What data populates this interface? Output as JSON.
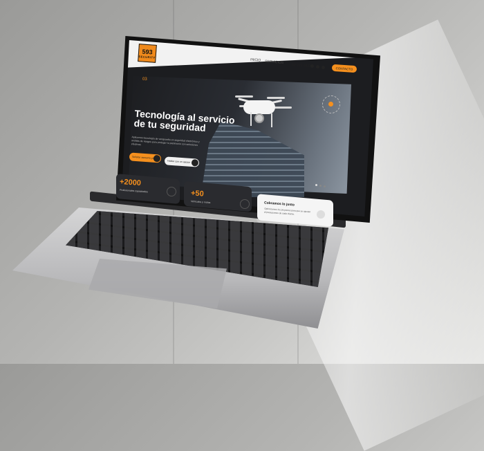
{
  "nav": {
    "logo_main": "593",
    "logo_sub": "SECURITY",
    "links": [
      "INICIO",
      "SERVICIOS"
    ],
    "phone": "02 225 0833",
    "contact_label": "CONTACTO"
  },
  "hero": {
    "counter": "03",
    "title": "Tecnología al servicio de tu seguridad",
    "description": "Aplicamos tecnología de vanguardia en seguridad electrónica y análisis de riesgos para proteger tu patrimonio con soluciones efectivas.",
    "primary_button": "Solicitar asesoría ya",
    "secondary_button": "Hablar con un asesor"
  },
  "stats": [
    {
      "number": "+2000",
      "label": "Profesionales capacitados"
    },
    {
      "number": "+50",
      "label": "Vehículos y motos"
    }
  ],
  "info_card": {
    "title": "Cobramos lo justo",
    "text": "Optimizamos los proyectos para que se ajusten al presupuesto de cada cliente."
  },
  "colors": {
    "accent": "#f5901e",
    "screen_bg": "#1c1d20",
    "navbar_bg": "#f2f2f2"
  }
}
